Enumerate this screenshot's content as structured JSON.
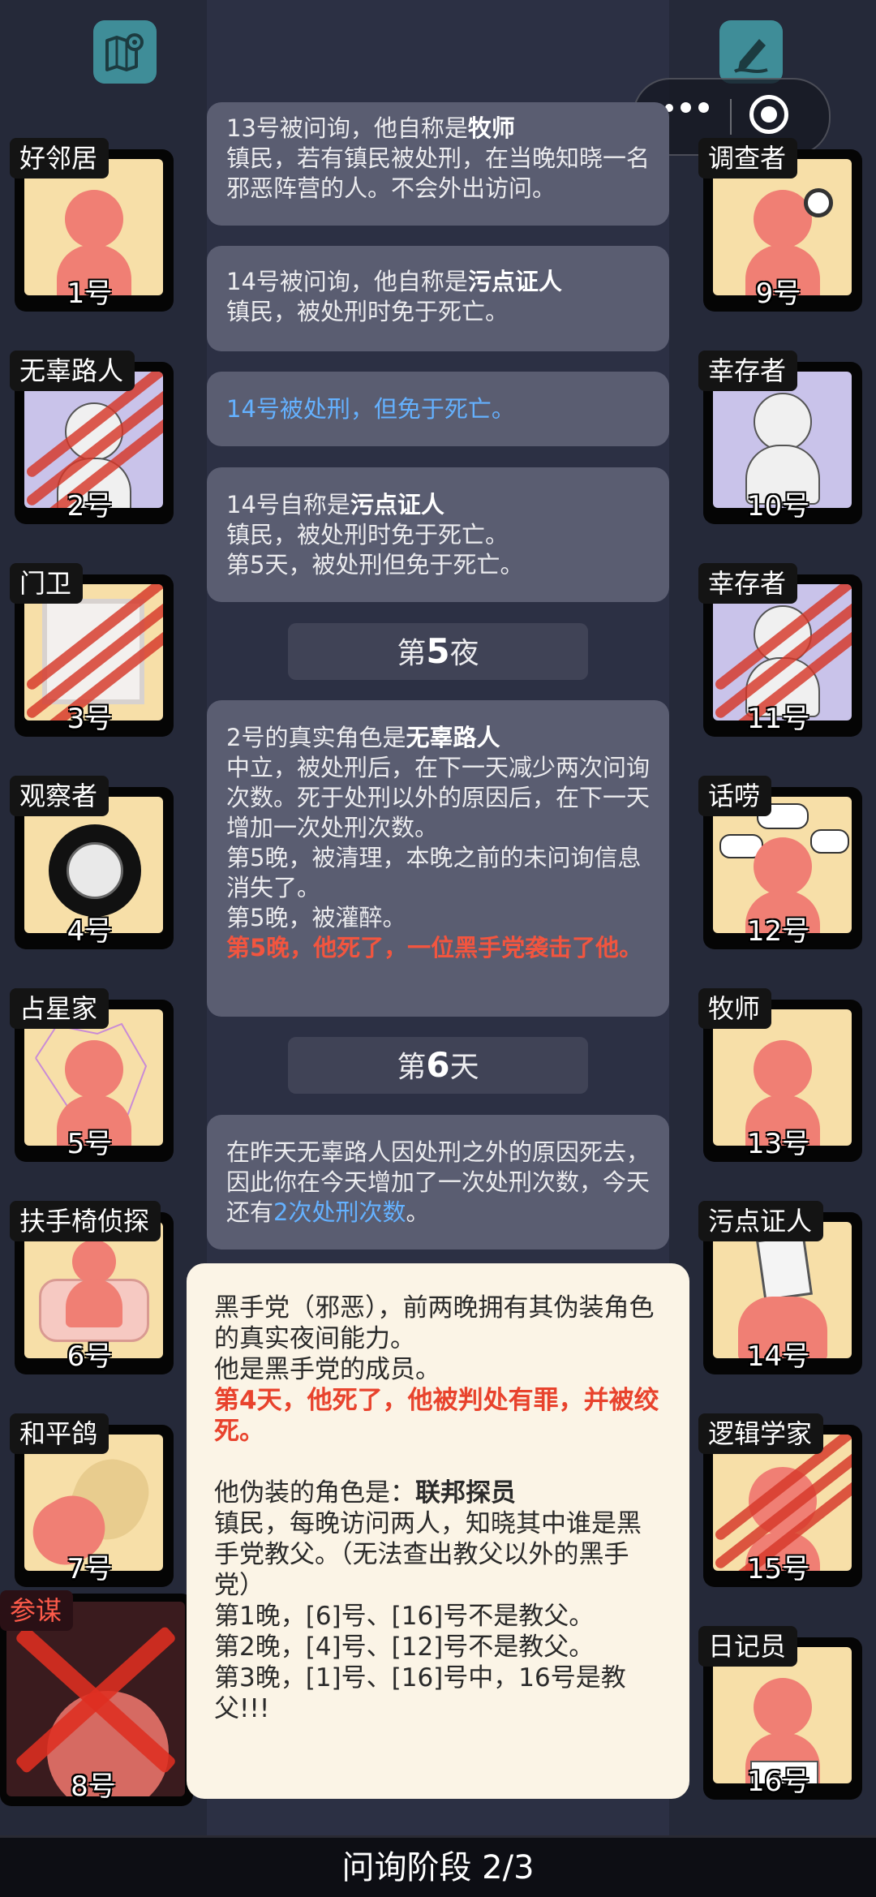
{
  "top": {
    "left_icon": "map-pin-icon",
    "right_icon": "pencil-note-icon"
  },
  "capsule": {
    "more_icon": "more-dots-icon",
    "target_icon": "target-circle-icon"
  },
  "left_players": [
    {
      "role": "好邻居",
      "num": "1号"
    },
    {
      "role": "无辜路人",
      "num": "2号"
    },
    {
      "role": "门卫",
      "num": "3号"
    },
    {
      "role": "观察者",
      "num": "4号"
    },
    {
      "role": "占星家",
      "num": "5号"
    },
    {
      "role": "扶手椅侦探",
      "num": "6号"
    },
    {
      "role": "和平鸽",
      "num": "7号"
    },
    {
      "role": "参谋",
      "num": "8号"
    }
  ],
  "right_players": [
    {
      "role": "调查者",
      "num": "9号"
    },
    {
      "role": "幸存者",
      "num": "10号"
    },
    {
      "role": "幸存者",
      "num": "11号"
    },
    {
      "role": "话唠",
      "num": "12号"
    },
    {
      "role": "牧师",
      "num": "13号"
    },
    {
      "role": "污点证人",
      "num": "14号"
    },
    {
      "role": "逻辑学家",
      "num": "15号"
    },
    {
      "role": "日记员",
      "num": "16号"
    }
  ],
  "log": {
    "m1_a": "13号被问询，他自称是",
    "m1_b": "牧师",
    "m1_c": "镇民，若有镇民被处刑，在当晚知晓一名邪恶阵营的人。不会外出访问。",
    "m2_a": "14号被问询，他自称是",
    "m2_b": "污点证人",
    "m2_c": "镇民，被处刑时免于死亡。",
    "m3": "14号被处刑，但免于死亡。",
    "m4_a": "14号自称是",
    "m4_b": "污点证人",
    "m4_c": "镇民，被处刑时免于死亡。",
    "m4_d": "第5天，被处刑但免于死亡。",
    "night_pre": "第",
    "night_num": "5",
    "night_post": "夜",
    "m5_a": "2号的真实角色是",
    "m5_b": "无辜路人",
    "m5_c": "中立，被处刑后，在下一天减少两次问询次数。死于处刑以外的原因后，在下一天增加一次处刑次数。",
    "m5_d": "第5晚，被清理，本晚之前的未问询信息消失了。",
    "m5_e": "第5晚，被灌醉。",
    "m5_f": "第5晚，他死了，一位黑手党袭击了他。",
    "day_pre": "第",
    "day_num": "6",
    "day_post": "天",
    "m6_a": "在昨天无辜路人因处刑之外的原因死去，因此你在今天增加了一次处刑次数，今天还有",
    "m6_b": "2次处刑次数",
    "m6_c": "。"
  },
  "popup": {
    "p1": "黑手党（邪恶），前两晚拥有其伪装角色的真实夜间能力。",
    "p2": "他是黑手党的成员。",
    "p3": "第4天，他死了，他被判处有罪，并被绞死。",
    "p4_a": "他伪装的角色是：",
    "p4_b": "联邦探员",
    "p5": "镇民，每晚访问两人，知晓其中谁是黑手党教父。（无法查出教父以外的黑手党）",
    "p6": "第1晚，[6]号、[16]号不是教父。",
    "p7": "第2晚，[4]号、[12]号不是教父。",
    "p8": "第3晚，[1]号、[16]号中，16号是教父!!!"
  },
  "bottom": {
    "phase": "问询阶段 2/3"
  },
  "colors": {
    "background": "#252939",
    "card_bg": "#f7dfa8",
    "log_bg": "#5a5d71",
    "accent_blue": "#64b1ff",
    "accent_red": "#f2553f",
    "teal": "#3f8d98"
  }
}
